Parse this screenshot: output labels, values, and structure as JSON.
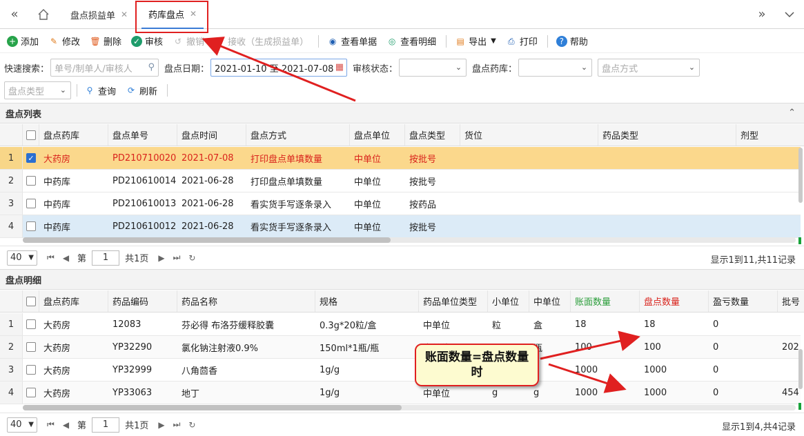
{
  "tabs": {
    "items": [
      {
        "label": "盘点损益单"
      },
      {
        "label": "药库盘点"
      }
    ],
    "close_glyph": "✕"
  },
  "toolbar": {
    "add": "添加",
    "edit": "修改",
    "delete": "删除",
    "audit": "审核",
    "revoke": "撤销",
    "receive": "接收（生成损益单）",
    "view_doc": "查看单据",
    "view_detail": "查看明细",
    "export": "导出",
    "print": "打印",
    "help": "帮助"
  },
  "search": {
    "quick_label": "快速搜索：",
    "quick_placeholder": "单号/制单人/审核人",
    "date_label": "盘点日期：",
    "date_value": "2021-01-10 至 2021-07-08",
    "audit_label": "审核状态：",
    "store_label": "盘点药库：",
    "method_placeholder": "盘点方式",
    "type_placeholder": "盘点类型",
    "query": "查询",
    "refresh": "刷新"
  },
  "list": {
    "title": "盘点列表",
    "columns": [
      "盘点药库",
      "盘点单号",
      "盘点时间",
      "盘点方式",
      "盘点单位",
      "盘点类型",
      "货位",
      "药品类型",
      "剂型"
    ],
    "rows": [
      {
        "n": "1",
        "store": "大药房",
        "no": "PD210710020",
        "time": "2021-07-08",
        "method": "打印盘点单填数量",
        "unit": "中单位",
        "type": "按批号"
      },
      {
        "n": "2",
        "store": "中药库",
        "no": "PD210610014",
        "time": "2021-06-28",
        "method": "打印盘点单填数量",
        "unit": "中单位",
        "type": "按批号"
      },
      {
        "n": "3",
        "store": "中药库",
        "no": "PD210610013",
        "time": "2021-06-28",
        "method": "看实货手写逐条录入",
        "unit": "中单位",
        "type": "按药品"
      },
      {
        "n": "4",
        "store": "中药库",
        "no": "PD210610012",
        "time": "2021-06-28",
        "method": "看实货手写逐条录入",
        "unit": "中单位",
        "type": "按批号"
      }
    ],
    "pager": {
      "size": "40",
      "page_prefix": "第",
      "page": "1",
      "page_suffix": "共1页",
      "info": "显示1到11,共11记录"
    }
  },
  "detail": {
    "title": "盘点明细",
    "columns": [
      "盘点药库",
      "药品编码",
      "药品名称",
      "规格",
      "药品单位类型",
      "小单位",
      "中单位",
      "账面数量",
      "盘点数量",
      "盈亏数量",
      "批号"
    ],
    "rows": [
      {
        "n": "1",
        "store": "大药房",
        "code": "12083",
        "name": "芬必得 布洛芬缓释胶囊",
        "spec": "0.3g*20粒/盒",
        "utype": "中单位",
        "small": "粒",
        "mid": "盒",
        "book": "18",
        "count": "18",
        "diff": "0",
        "batch": ""
      },
      {
        "n": "2",
        "store": "大药房",
        "code": "YP32290",
        "name": "氯化钠注射液0.9%",
        "spec": "150ml*1瓶/瓶",
        "utype": "中单位",
        "small": "",
        "mid": "瓶",
        "book": "100",
        "count": "100",
        "diff": "0",
        "batch": "202"
      },
      {
        "n": "3",
        "store": "大药房",
        "code": "YP32999",
        "name": "八角茴香",
        "spec": "1g/g",
        "utype": "",
        "small": "",
        "mid": "",
        "book": "1000",
        "count": "1000",
        "diff": "0",
        "batch": ""
      },
      {
        "n": "4",
        "store": "大药房",
        "code": "YP33063",
        "name": "地丁",
        "spec": "1g/g",
        "utype": "中单位",
        "small": "g",
        "mid": "g",
        "book": "1000",
        "count": "1000",
        "diff": "0",
        "batch": "454"
      }
    ],
    "pager": {
      "size": "40",
      "page_prefix": "第",
      "page": "1",
      "page_suffix": "共1页",
      "info": "显示1到4,共4记录"
    }
  },
  "annotation": {
    "callout_text": "账面数量=盘点数量时"
  },
  "colors": {
    "accent": "#3a7bd5",
    "selected_row": "#fbd88c",
    "selected_text": "#d9231c",
    "annotation_red": "#e02020"
  }
}
